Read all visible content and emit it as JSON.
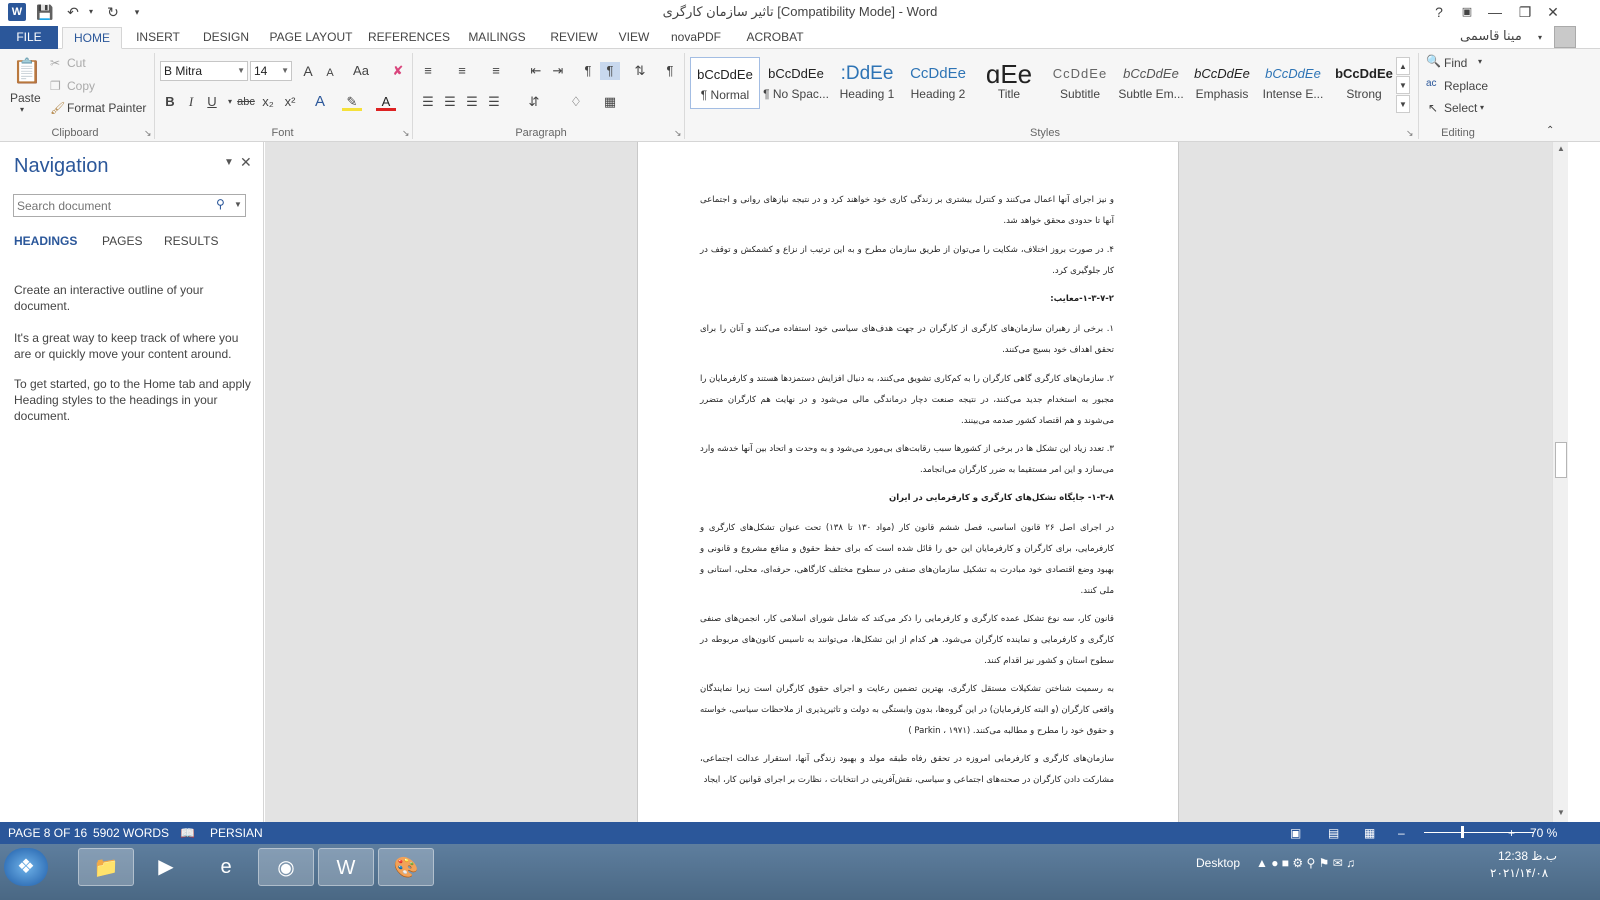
{
  "window": {
    "title": "تاثیر سازمان کارگری [Compatibility Mode] - Word",
    "help": "?",
    "user_name": "مینا قاسمی"
  },
  "tabs": [
    "FILE",
    "HOME",
    "INSERT",
    "DESIGN",
    "PAGE LAYOUT",
    "REFERENCES",
    "MAILINGS",
    "REVIEW",
    "VIEW",
    "novaPDF",
    "ACROBAT"
  ],
  "active_tab": "HOME",
  "ribbon": {
    "clipboard": {
      "group_label": "Clipboard",
      "paste": "Paste",
      "cut": "Cut",
      "copy": "Copy",
      "format_painter": "Format Painter"
    },
    "font": {
      "group_label": "Font",
      "font_name": "B Mitra",
      "font_size": "14",
      "bold": "B",
      "italic": "I",
      "underline": "U",
      "strikethrough": "abc",
      "subscript": "x₂",
      "superscript": "x²",
      "change_case": "Aa",
      "grow": "A",
      "shrink": "A",
      "text_effects": "A",
      "font_color": "A"
    },
    "paragraph": {
      "group_label": "Paragraph"
    },
    "styles": {
      "group_label": "Styles",
      "items": [
        {
          "preview": "bCcDdEe",
          "name": "¶ Normal"
        },
        {
          "preview": "bCcDdEe",
          "name": "¶ No Spac..."
        },
        {
          "preview": ":DdEe",
          "name": "Heading 1"
        },
        {
          "preview": "CcDdEe",
          "name": "Heading 2"
        },
        {
          "preview": "ɑEe",
          "name": "Title"
        },
        {
          "preview": "CcDdEe",
          "name": "Subtitle"
        },
        {
          "preview": "bCcDdEe",
          "name": "Subtle Em..."
        },
        {
          "preview": "bCcDdEe",
          "name": "Emphasis"
        },
        {
          "preview": "bCcDdEe",
          "name": "Intense E..."
        },
        {
          "preview": "bCcDdEe",
          "name": "Strong"
        }
      ]
    },
    "editing": {
      "group_label": "Editing",
      "find": "Find",
      "replace": "Replace",
      "select": "Select"
    }
  },
  "navigation": {
    "title": "Navigation",
    "search_placeholder": "Search document",
    "tabs": [
      "HEADINGS",
      "PAGES",
      "RESULTS"
    ],
    "paragraphs": [
      "Create an interactive outline of your document.",
      "It's a great way to keep track of where you are or quickly move your content around.",
      "To get started, go to the Home tab and apply Heading styles to the headings in your document."
    ]
  },
  "document": {
    "paragraphs": [
      "و نیز اجرای آنها اعمال می‌کنند و کنترل بیشتری بر زندگی کاری خود خواهند کرد و در نتیجه نیازهای روانی و اجتماعی آنها تا حدودی محقق خواهد شد.",
      "۴. در صورت بروز اختلاف، شکایت را می‌توان از طریق سازمان مطرح و به این ترتیب از نزاع و کشمکش و توقف در کار جلوگیری کرد.",
      "۱-۳-۷-۲-معایب:",
      "۱. برخی از رهبران سازمان‌های کارگری از کارگران در جهت هدف‌های سیاسی خود استفاده می‌کنند و آنان را برای تحقق اهداف خود بسیج می‌کنند.",
      "۲. سازمان‌های کارگری گاهی کارگران را به کم‌کاری تشویق می‌کنند، به دنبال افزایش دستمزدها هستند و کارفرمایان را مجبور به استخدام جدید می‌کنند، در نتیجه صنعت دچار درماندگی مالی می‌شود و در نهایت هم کارگران متضرر می‌شوند و هم اقتصاد کشور صدمه می‌بینند.",
      "۳. تعدد زیاد این تشکل ها در برخی از کشورها سبب رقابت‌های بی‌مورد می‌شود و به وحدت و اتحاد بین آنها خدشه وارد می‌سازد و این امر مستقیما به ضرر کارگران می‌انجامد.",
      "۱-۳-۸- جایگاه تشکل‌های کارگری و کارفرمایی در ایران",
      "در اجرای اصل ۲۶ قانون اساسی، فصل ششم قانون کار (مواد ۱۳۰ تا ۱۳۸) تحت عنوان تشکل‌های کارگری و کارفرمایی، برای کارگران و کارفرمایان این حق را قائل شده است که برای حفظ حقوق و منافع مشروع و قانونی و بهبود وضع اقتصادی خود مبادرت به تشکیل سازمان‌های صنفی در سطوح مختلف کارگاهی، حرفه‌ای، محلی، استانی و ملی کنند.",
      "قانون کار، سه نوع تشکل عمده کارگری و کارفرمایی را ذکر می‌کند که شامل شورای اسلامی کار، انجمن‌های صنفی کارگری و کارفرمایی و نماینده کارگران می‌شود. هر کدام از این تشکل‌ها، می‌توانند به تاسیس کانون‌های مربوطه در سطوح استان و کشور نیز اقدام کنند.",
      "به رسمیت شناختن تشکیلات مستقل کارگری، بهترین تضمین رعایت و اجرای حقوق کارگران است زیرا نمایندگان واقعی کارگران (و البته کارفرمایان) در این گروه‌ها، بدون وابستگی به دولت و تاثیرپذیری از ملاحظات سیاسی، خواسته و حقوق خود را مطرح و مطالبه می‌کنند. (Parkin ، ۱۹۷۱ )",
      "سازمان‌های کارگری و کارفرمایی امروزه در تحقق رفاه طبقه مولد و بهبود زندگی آنها، استقرار عدالت اجتماعی، مشارکت دادن کارگران در صحنه‌های اجتماعی و سیاسی، نقش‌آفرینی در انتخابات ، نظارت بر اجرای قوانین کار، ایجاد"
    ]
  },
  "status": {
    "page": "PAGE 8 OF 16",
    "words": "5902 WORDS",
    "language": "PERSIAN",
    "zoom": "70 %",
    "zoom_level_percent": 70
  },
  "taskbar": {
    "desktop_label": "Desktop",
    "time": "12:38 ب.ظ",
    "date": "۲۰۲۱/۱۴/۰۸"
  },
  "colors": {
    "accent": "#2b579a"
  }
}
